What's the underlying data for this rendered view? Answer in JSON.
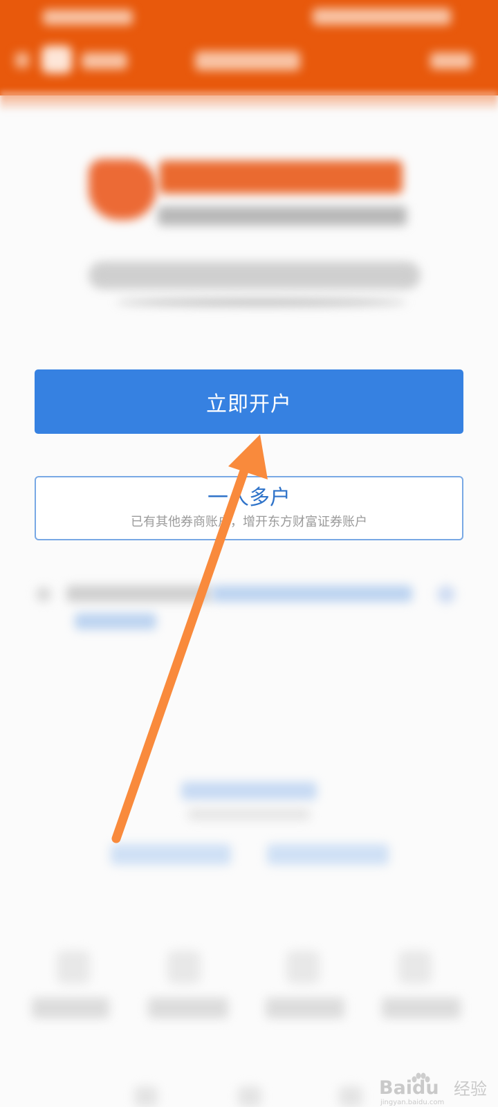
{
  "actions": {
    "open_account_label": "立即开户",
    "multi_account_title": "一人多户",
    "multi_account_subtitle": "已有其他券商账户，增开东方财富证券账户"
  },
  "colors": {
    "header": "#e8590c",
    "primary_button": "#3681e1",
    "secondary_border": "#78a8e4",
    "annotation_arrow": "#f98a3c"
  },
  "annotation": {
    "arrow_icon": "arrow-up-icon"
  },
  "watermark": {
    "brand": "Baidu",
    "suffix": "经验",
    "url": "jingyan.baidu.com"
  }
}
